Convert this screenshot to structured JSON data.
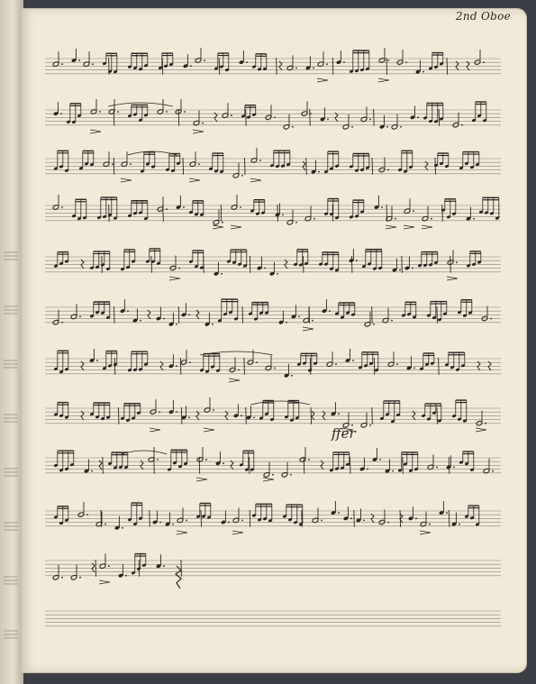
{
  "document": {
    "part_label": "2nd Oboe",
    "marking": "ffer"
  },
  "colors": {
    "paper": "#f1ead9",
    "ink": "#2a2520",
    "staff_line": "#8a8378",
    "background": "#3a3e44"
  }
}
